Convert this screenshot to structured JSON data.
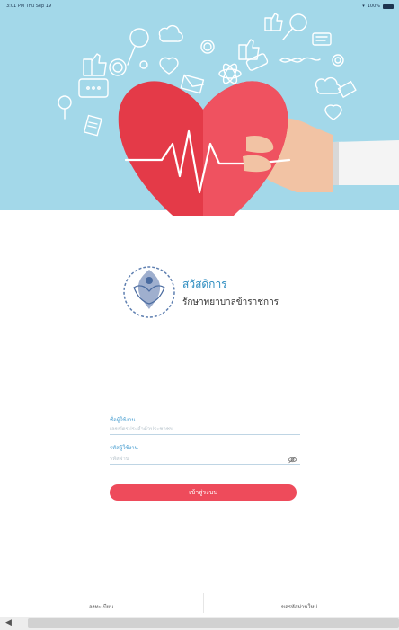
{
  "status_bar": {
    "time": "3:01 PM  Thu Sep 19",
    "battery": "100%"
  },
  "org": {
    "title": "สวัสดิการ",
    "subtitle": "รักษาพยาบาลข้าราชการ"
  },
  "form": {
    "username": {
      "label": "ชื่อผู้ใช้งาน",
      "placeholder": "เลขบัตรประจำตัวประชาชน"
    },
    "password": {
      "label": "รหัสผู้ใช้งาน",
      "placeholder": "รหัสผ่าน"
    },
    "login_label": "เข้าสู่ระบบ"
  },
  "bottom": {
    "register": "ลงทะเบียน",
    "forgot": "ขอรหัสผ่านใหม่"
  },
  "colors": {
    "hero_bg": "#a3d8e9",
    "heart": "#e43a48",
    "accent": "#ee4b5b",
    "link": "#4a9fd1"
  },
  "icons": [
    "thumbs-up-icon",
    "gear-icon",
    "magnifier-icon",
    "cloud-icon",
    "mail-icon",
    "atom-icon",
    "chat-icon",
    "dna-icon",
    "lightbulb-icon",
    "document-icon",
    "heart-icon",
    "eye-slash-icon",
    "back-arrow-icon"
  ]
}
